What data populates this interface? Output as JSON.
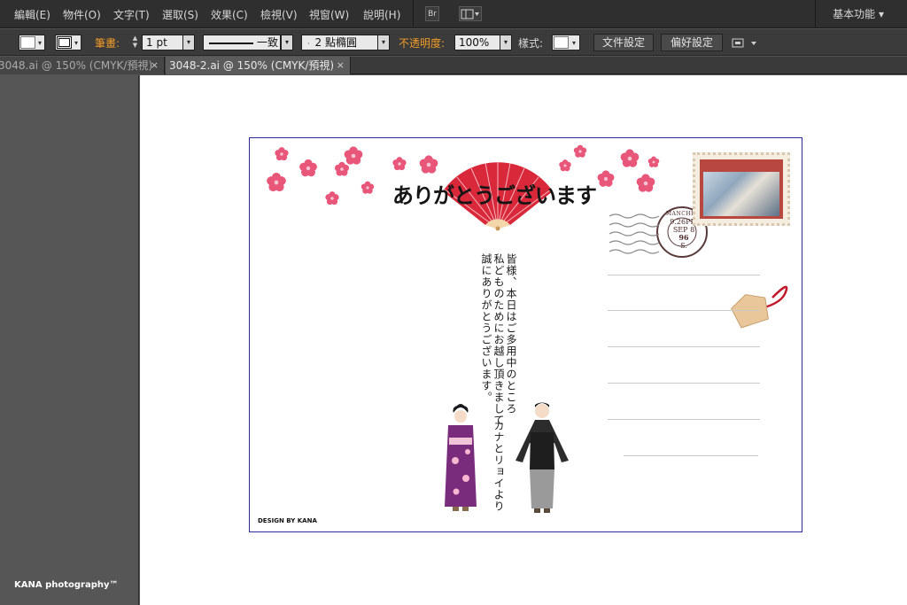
{
  "menubar": {
    "items": [
      "編輯(E)",
      "物件(O)",
      "文字(T)",
      "選取(S)",
      "效果(C)",
      "檢視(V)",
      "視窗(W)",
      "說明(H)"
    ],
    "bridge_label": "Br",
    "workspace_label": "基本功能"
  },
  "control": {
    "stroke_label": "筆畫:",
    "stroke_weight": "1 pt",
    "profile_label": "一致",
    "brush_label": "2 點橢圓",
    "opacity_label": "不透明度:",
    "opacity_value": "100%",
    "style_label": "樣式:",
    "doc_setup_button": "文件設定",
    "prefs_button": "偏好設定",
    "accent_orange": "#f39c26"
  },
  "tabs": [
    {
      "label": "3048.ai @ 150% (CMYK/預視)",
      "close": "×",
      "active": false
    },
    {
      "label": "3048-2.ai @ 150% (CMYK/預視)",
      "close": "×",
      "active": true
    }
  ],
  "watermark": "KANA photography™",
  "card": {
    "title": "ありがとうございます",
    "message_lines": [
      "皆様、本日はご多用中のところ",
      "私どものためにお越し頂きまして",
      "誠にありがとうございます。"
    ],
    "signature": "カナとリョイより",
    "credit": "DESIGN BY KANA",
    "postmark_text": "MANCHESTER",
    "postmark_date_lines": [
      "9.26PM",
      "SEP 8",
      "96"
    ],
    "postmark_bottom": "S.",
    "border_color": "#2a2a9a",
    "fan_color": "#d8283a",
    "flower_color": "#e8577a"
  }
}
